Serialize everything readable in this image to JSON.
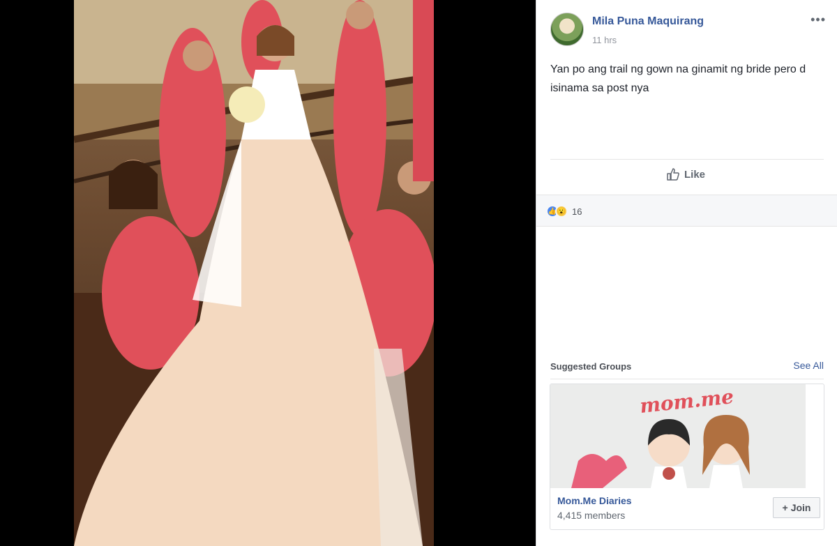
{
  "post": {
    "author": "Mila Puna Maquirang",
    "timestamp": "11 hrs",
    "more_icon": "•••",
    "text": "Yan po ang trail ng gown na ginamit ng bride pero d isinama sa post nya"
  },
  "actions": {
    "like_label": "Like"
  },
  "reactions": {
    "like_glyph": "👍",
    "wow_glyph": "😮",
    "count": "16"
  },
  "suggested_groups": {
    "title": "Suggested Groups",
    "see_all": "See All",
    "group": {
      "logo_text": "mom.me",
      "name": "Mom.Me Diaries",
      "members": "4,415 members",
      "join_label": "Join",
      "join_icon": "+"
    }
  },
  "colors": {
    "link": "#365899",
    "dress": "#e0505a",
    "gown": "#f4d9c0"
  }
}
